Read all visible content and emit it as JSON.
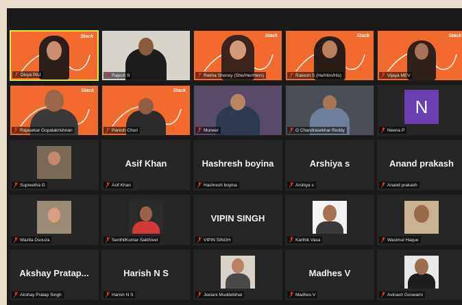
{
  "brand_mark": "Stack",
  "colors": {
    "brand_orange": "#f26a2e",
    "active_speaker": "#d9e84a",
    "tile_bg": "#262626",
    "avatar_purple": "#6a3fb0"
  },
  "participants": [
    {
      "label": "Divya PAJ"
    },
    {
      "label": "Rajesh S"
    },
    {
      "label": "Rekha Shenoy (She/Her/Hers)"
    },
    {
      "label": "Rakesh S (He/Him/His)"
    },
    {
      "label": "Vijaya MEV"
    },
    {
      "label": "Rajasekar Gopalakrishnan"
    },
    {
      "label": "Paresh Churi"
    },
    {
      "label": "Muneer"
    },
    {
      "label": "G Chandrasekhar Reddy"
    },
    {
      "label": "Neena P",
      "avatar": "N"
    },
    {
      "label": "Supreetha G"
    },
    {
      "label": "Asif Khan",
      "display": "Asif Khan"
    },
    {
      "label": "Hashresh boyina",
      "display": "Hashresh boyina"
    },
    {
      "label": "Arshiya s",
      "display": "Arshiya s"
    },
    {
      "label": "Anand prakash",
      "display": "Anand prakash"
    },
    {
      "label": "Wazita Dsouza"
    },
    {
      "label": "SenthilKumar Sakthivel"
    },
    {
      "label": "VIPIN SINGH",
      "display": "VIPIN SINGH"
    },
    {
      "label": "Karthik Vasa"
    },
    {
      "label": "Wasimul Haque"
    },
    {
      "label": "Akshay Pratap Singh",
      "display": "Akshay  Pratap..."
    },
    {
      "label": "Harish N S",
      "display": "Harish N S"
    },
    {
      "label": "Jeelani Muddebihal"
    },
    {
      "label": "Madhes V",
      "display": "Madhes V"
    },
    {
      "label": "Avinash Goswami"
    }
  ]
}
